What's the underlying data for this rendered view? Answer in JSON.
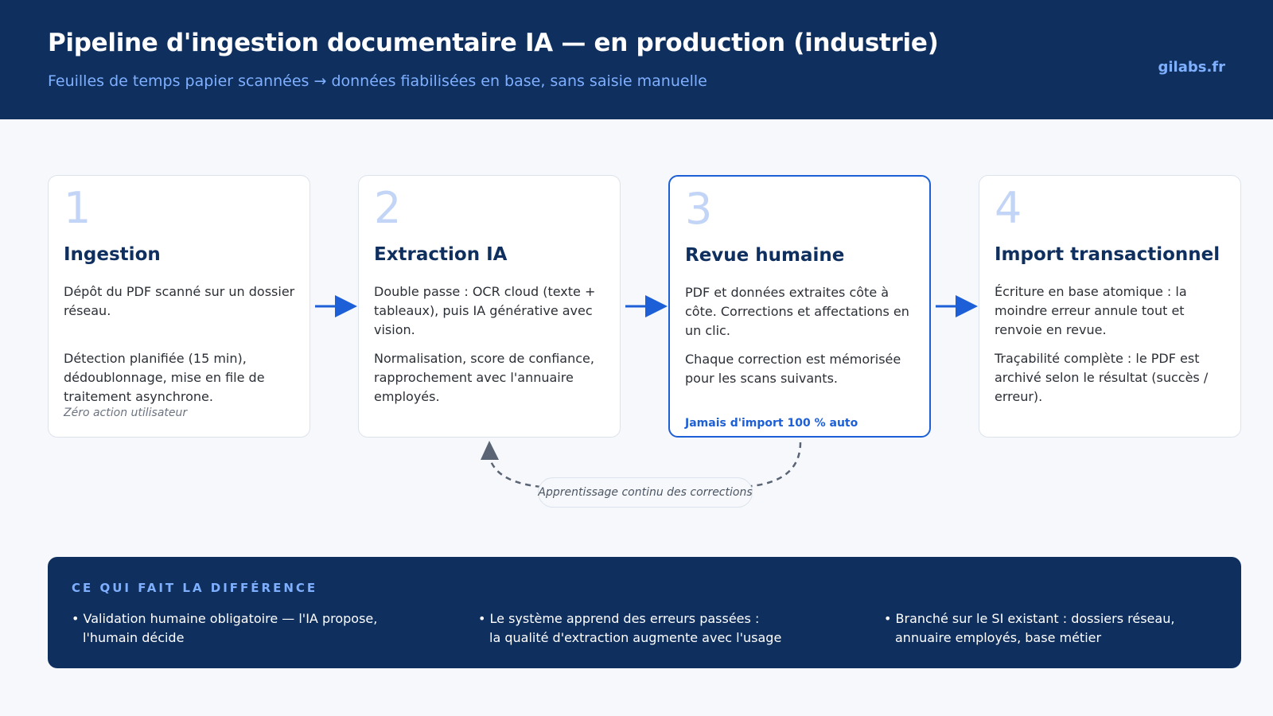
{
  "header": {
    "title": "Pipeline d'ingestion documentaire IA — en production (industrie)",
    "subtitle": "Feuilles de temps papier scannées → données fiabilisées en base, sans saisie manuelle",
    "brand": "gilabs.fr"
  },
  "steps": [
    {
      "num": "1",
      "title": "Ingestion",
      "p1": "Dépôt du PDF scanné sur un dossier réseau.",
      "p2": "Détection planifiée (15 min), dédoublonnage, mise en file de traitement asynchrone.",
      "note": "Zéro action utilisateur"
    },
    {
      "num": "2",
      "title": "Extraction IA",
      "p1": "Double passe : OCR cloud (texte + tableaux), puis IA générative avec vision.",
      "p2": "Normalisation, score de confiance, rapprochement avec l'annuaire employés."
    },
    {
      "num": "3",
      "title": "Revue humaine",
      "p1": "PDF et données extraites côte à côte. Corrections et affectations en un clic.",
      "p2": "Chaque correction est mémorisée pour les scans suivants.",
      "note": "Jamais d'import 100 % auto"
    },
    {
      "num": "4",
      "title": "Import transactionnel",
      "p1": "Écriture en base atomique : la moindre erreur annule tout et renvoie en revue.",
      "p2": "Traçabilité complète : le PDF est archivé selon le résultat (succès / erreur)."
    }
  ],
  "loop": {
    "label": "Apprentissage continu des corrections"
  },
  "difference": {
    "title": "CE QUI FAIT LA DIFFÉRENCE",
    "items": [
      {
        "line1": "• Validation humaine obligatoire — l'IA propose,",
        "line2": "l'humain décide"
      },
      {
        "line1": "• Le système apprend des erreurs passées :",
        "line2": "la qualité d'extraction augmente avec l'usage"
      },
      {
        "line1": "• Branché sur le SI existant : dossiers réseau,",
        "line2": "annuaire employés, base métier"
      }
    ]
  },
  "colors": {
    "navy": "#0f2f5f",
    "accent": "#1d5fd6",
    "light_blue": "#7fb0ff",
    "number": "#c3d5f6"
  },
  "icons": [
    "arrow-right-icon",
    "loop-arrow-icon"
  ]
}
